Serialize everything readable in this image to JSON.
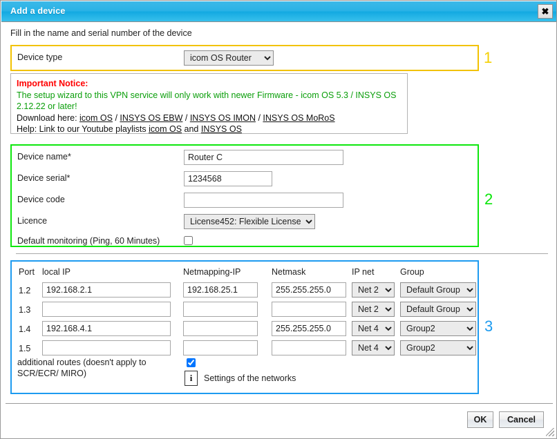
{
  "window": {
    "title": "Add a device",
    "close_label": "✖",
    "subtitle": "Fill in the name and serial number of the device"
  },
  "markers": {
    "one": "1",
    "two": "2",
    "three": "3"
  },
  "section1": {
    "label": "Device type",
    "selected": "icom OS Router",
    "options": [
      "icom OS Router"
    ]
  },
  "notice": {
    "heading": "Important Notice:",
    "line1": "The setup wizard to this VPN service will only work with newer Firmware - icom OS 5.3 / INSYS OS 2.12.22 or later!",
    "download_prefix": "Download here: ",
    "download_links": [
      "icom OS",
      "INSYS OS EBW",
      "INSYS OS IMON",
      "INSYS OS MoRoS"
    ],
    "help_prefix": "Help: Link to our Youtube playlists ",
    "help_link1": "icom OS",
    "help_joiner": " and ",
    "help_link2": "INSYS OS",
    "separator": " / "
  },
  "section2": {
    "device_name": {
      "label": "Device name*",
      "value": "Router C",
      "placeholder": ""
    },
    "device_serial": {
      "label": "Device serial*",
      "value": "1234568",
      "placeholder": ""
    },
    "device_code": {
      "label": "Device code",
      "value": "",
      "placeholder": ""
    },
    "licence": {
      "label": "Licence",
      "selected": "License452: Flexible License",
      "options": [
        "License452: Flexible License"
      ]
    },
    "monitoring": {
      "label": "Default monitoring (Ping, 60 Minutes)",
      "checked": false
    }
  },
  "section3": {
    "headers": [
      "Port",
      "local IP",
      "Netmapping-IP",
      "Netmask",
      "IP net",
      "Group"
    ],
    "rows": [
      {
        "port": "1.2",
        "local_ip": "192.168.2.1",
        "netmapping_ip": "192.168.25.1",
        "netmask": "255.255.255.0",
        "ip_net": "Net 2",
        "group": "Default Group"
      },
      {
        "port": "1.3",
        "local_ip": "",
        "netmapping_ip": "",
        "netmask": "",
        "ip_net": "Net 2",
        "group": "Default Group"
      },
      {
        "port": "1.4",
        "local_ip": "192.168.4.1",
        "netmapping_ip": "",
        "netmask": "255.255.255.0",
        "ip_net": "Net 4",
        "group": "Group2"
      },
      {
        "port": "1.5",
        "local_ip": "",
        "netmapping_ip": "",
        "netmask": "",
        "ip_net": "Net 4",
        "group": "Group2"
      }
    ],
    "ipnet_options": [
      "Net 2",
      "Net 4"
    ],
    "group_options": [
      "Default Group",
      "Group2"
    ],
    "additional_routes": {
      "label": "additional routes (doesn't apply to SCR/ECR/ MIRO)",
      "checked": true
    },
    "info_icon_glyph": "i",
    "info_label": "Settings of the networks"
  },
  "footer": {
    "ok_label": "OK",
    "cancel_label": "Cancel"
  },
  "colors": {
    "titlebar": "#29b2e6",
    "marker1": "#f5d000",
    "marker2": "#09e609",
    "marker3": "#1d9bf0",
    "notice_heading": "#ff0000",
    "notice_body": "#0a9e0a"
  }
}
